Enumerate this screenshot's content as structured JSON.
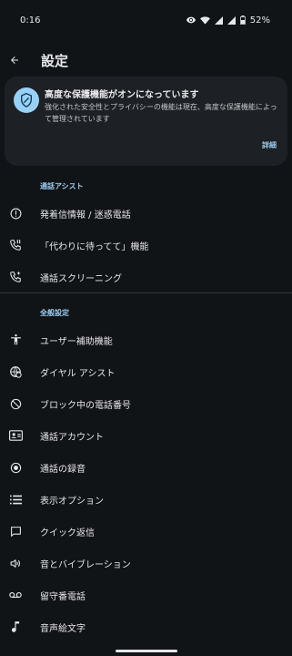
{
  "status_bar": {
    "time": "0:16",
    "battery": "52%",
    "icons": [
      "eye-icon",
      "wifi-icon",
      "signal-icon",
      "signal-icon",
      "battery-icon"
    ]
  },
  "app_bar": {
    "title": "設定",
    "back_icon": "arrow-back-icon"
  },
  "protection_card": {
    "icon": "shield-icon",
    "title": "高度な保護機能がオンになっています",
    "description": "強化された安全性とプライバシーの機能は現在、高度な保護機能によって管理されています",
    "link": "詳細"
  },
  "sections": [
    {
      "header": "通話アシスト",
      "items": [
        {
          "label": "発着信情報 / 迷惑電話",
          "icon": "info-icon"
        },
        {
          "label": "「代わりに待ってて」機能",
          "icon": "call-hold-icon"
        },
        {
          "label": "通話スクリーニング",
          "icon": "call-screen-icon"
        }
      ]
    },
    {
      "header": "全般設定",
      "items": [
        {
          "label": "ユーザー補助機能",
          "icon": "accessibility-icon"
        },
        {
          "label": "ダイヤル アシスト",
          "icon": "dial-assist-icon"
        },
        {
          "label": "ブロック中の電話番号",
          "icon": "block-icon"
        },
        {
          "label": "通話アカウント",
          "icon": "contact-card-icon"
        },
        {
          "label": "通話の録音",
          "icon": "record-icon"
        },
        {
          "label": "表示オプション",
          "icon": "list-icon"
        },
        {
          "label": "クイック返信",
          "icon": "chat-icon"
        },
        {
          "label": "音とバイブレーション",
          "icon": "volume-icon"
        },
        {
          "label": "留守番電話",
          "icon": "voicemail-icon"
        },
        {
          "label": "音声絵文字",
          "icon": "music-note-icon"
        }
      ]
    }
  ],
  "colors": {
    "background": "#111417",
    "card": "#1d2024",
    "accent": "#9ccdf2",
    "shield_bg": "#99d0f6"
  }
}
